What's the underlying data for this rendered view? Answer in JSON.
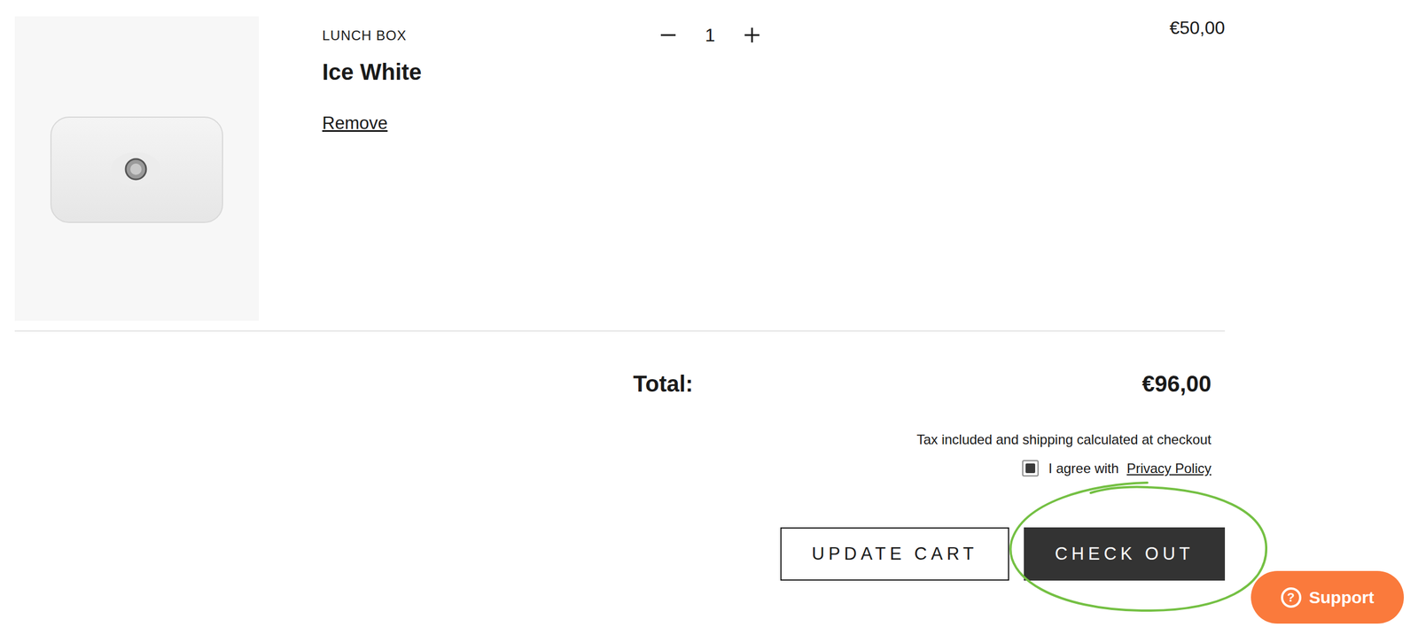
{
  "cart": {
    "items": [
      {
        "brand": "LUNCH BOX",
        "name": "Ice White",
        "remove": "Remove",
        "quantity": "1",
        "price": "€50,00"
      }
    ]
  },
  "summary": {
    "total_label": "Total:",
    "total_value": "€96,00",
    "tax_note": "Tax included and shipping calculated at checkout"
  },
  "agreement": {
    "text": "I agree with",
    "link": "Privacy Policy",
    "checked": true
  },
  "buttons": [
    {
      "label": "UPDATE CART",
      "kind": "outline"
    },
    {
      "label": "CHECK OUT",
      "kind": "solid",
      "highlighted": true
    }
  ],
  "support": {
    "icon": "?",
    "label": "Support"
  }
}
